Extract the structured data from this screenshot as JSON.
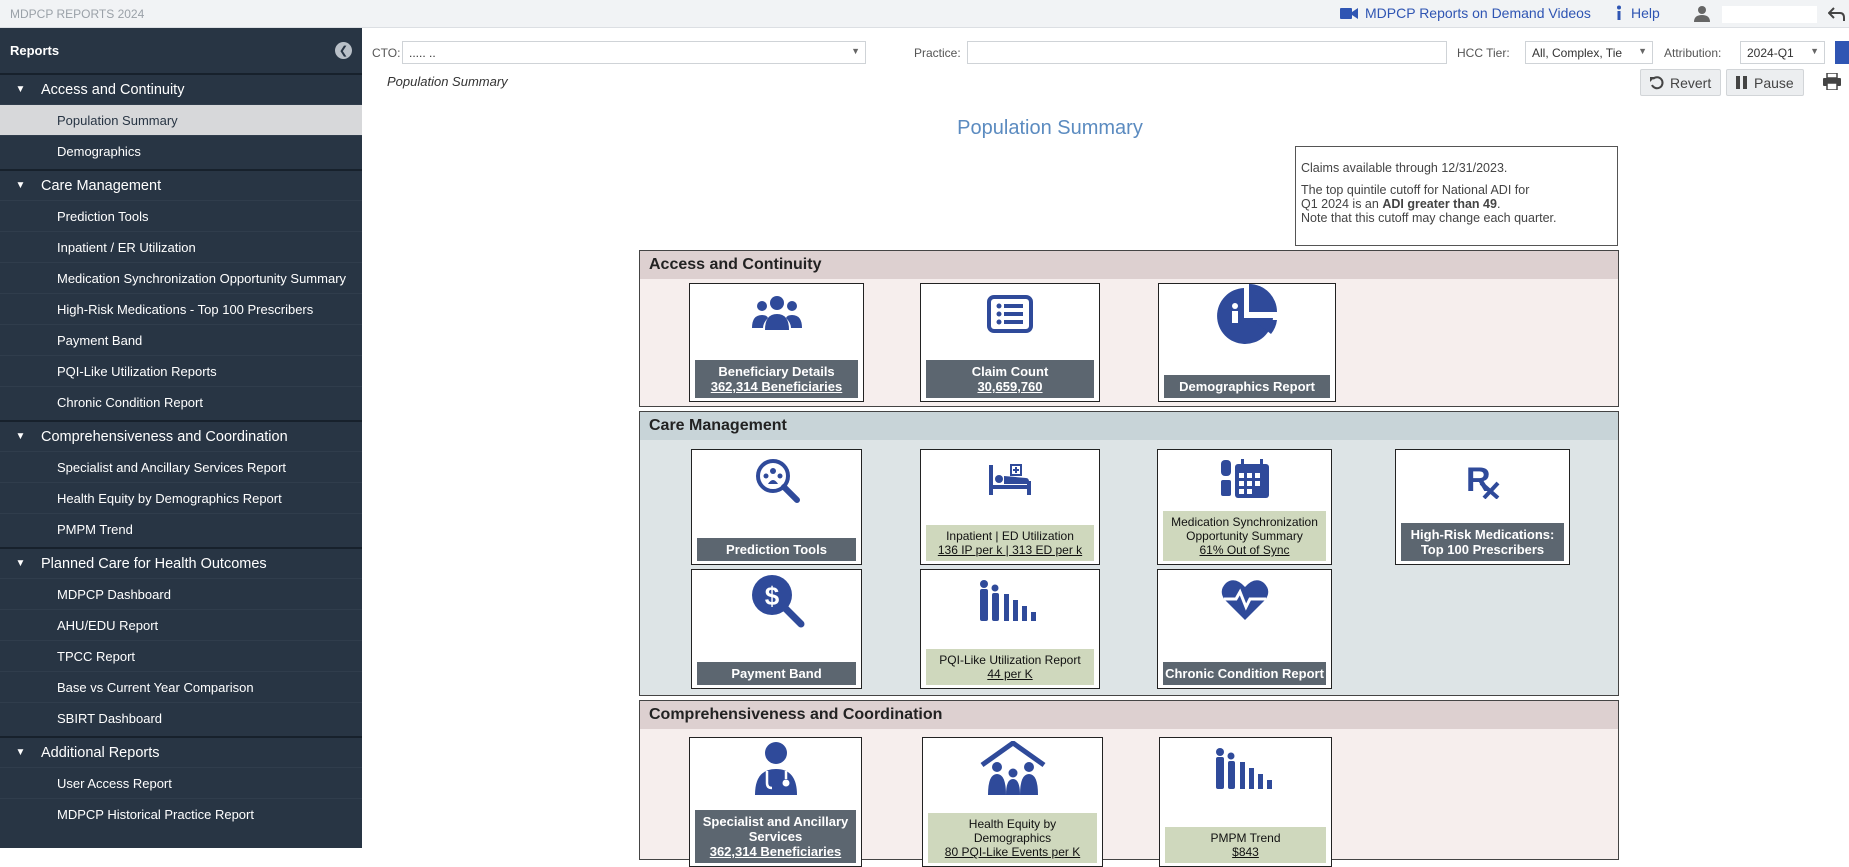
{
  "app_title": "MDPCP REPORTS 2024",
  "topnav": {
    "videos": "MDPCP Reports on Demand Videos",
    "help": "Help"
  },
  "sidebar": {
    "title": "Reports",
    "groups": [
      {
        "label": "Access and Continuity",
        "items": [
          "Population Summary",
          "Demographics"
        ]
      },
      {
        "label": "Care Management",
        "items": [
          "Prediction Tools",
          "Inpatient / ER Utilization",
          "Medication Synchronization Opportunity Summary",
          "High-Risk Medications - Top 100 Prescribers",
          "Payment Band",
          "PQI-Like Utilization Reports",
          "Chronic Condition Report"
        ]
      },
      {
        "label": "Comprehensiveness and Coordination",
        "items": [
          "Specialist and Ancillary Services Report",
          "Health Equity by Demographics Report",
          "PMPM Trend"
        ]
      },
      {
        "label": "Planned Care for Health Outcomes",
        "items": [
          "MDPCP Dashboard",
          "AHU/EDU Report",
          "TPCC Report",
          "Base vs Current Year Comparison",
          "SBIRT Dashboard"
        ]
      },
      {
        "label": "Additional Reports",
        "items": [
          "User Access Report",
          "MDPCP Historical Practice Report"
        ]
      }
    ]
  },
  "filters": {
    "cto_label": "CTO:",
    "cto_value": "..... ..",
    "practice_label": "Practice:",
    "hcc_label": "HCC Tier:",
    "hcc_value": "All, Complex, Tie",
    "attribution_label": "Attribution:",
    "attribution_value": "2024-Q1"
  },
  "toolbar": {
    "revert": "Revert",
    "pause": "Pause"
  },
  "breadcrumb": "Population Summary",
  "page_title": "Population Summary",
  "info": {
    "line1": "Claims available through 12/31/2023.",
    "line2a": "The top quintile cutoff for National ADI for",
    "line2b": "Q1 2024 is an",
    "line2bold": "ADI greater than 49",
    "line2c": ".",
    "line3": "Note that this cutoff may change each quarter."
  },
  "sections": {
    "access": {
      "title": "Access and Continuity",
      "cards": [
        {
          "title": "Beneficiary Details",
          "sub": "362,314 Beneficiaries",
          "icon": "users-icon"
        },
        {
          "title": "Claim Count",
          "sub": "30,659,760",
          "icon": "list-icon"
        },
        {
          "title": "Demographics Report",
          "sub": "",
          "icon": "pie-chart-icon"
        }
      ]
    },
    "care": {
      "title": "Care Management",
      "cards": [
        {
          "title": "Prediction Tools",
          "sub": "",
          "icon": "search-people-icon"
        },
        {
          "title": "Inpatient | ED Utilization",
          "sub": "136 IP per k  |  313 ED per k",
          "icon": "hospital-bed-icon"
        },
        {
          "title": "Medication Synchronization Opportunity Summary",
          "sub": "61% Out of Sync",
          "icon": "pills-calendar-icon"
        },
        {
          "title": "High-Risk Medications: Top 100 Prescribers",
          "sub": "",
          "icon": "rx-icon"
        },
        {
          "title": "Payment Band",
          "sub": "",
          "icon": "dollar-search-icon"
        },
        {
          "title": "PQI-Like Utilization Report",
          "sub": "44 per K",
          "icon": "people-bars-icon"
        },
        {
          "title": "Chronic Condition Report",
          "sub": "",
          "icon": "heartbeat-icon"
        }
      ]
    },
    "comp": {
      "title": "Comprehensiveness and Coordination",
      "cards": [
        {
          "title": "Specialist and Ancillary Services",
          "sub": "362,314 Beneficiaries",
          "icon": "doctor-icon"
        },
        {
          "title": "Health Equity by Demographics",
          "sub": "80 PQI-Like Events per K",
          "icon": "family-house-icon"
        },
        {
          "title": "PMPM Trend",
          "sub": "$843",
          "icon": "people-bars-icon"
        }
      ]
    }
  },
  "colors": {
    "sidebar": "#283544",
    "icon_blue": "#2f4a9a",
    "card_gray": "#5c6670",
    "card_green": "#cfd8bd"
  }
}
